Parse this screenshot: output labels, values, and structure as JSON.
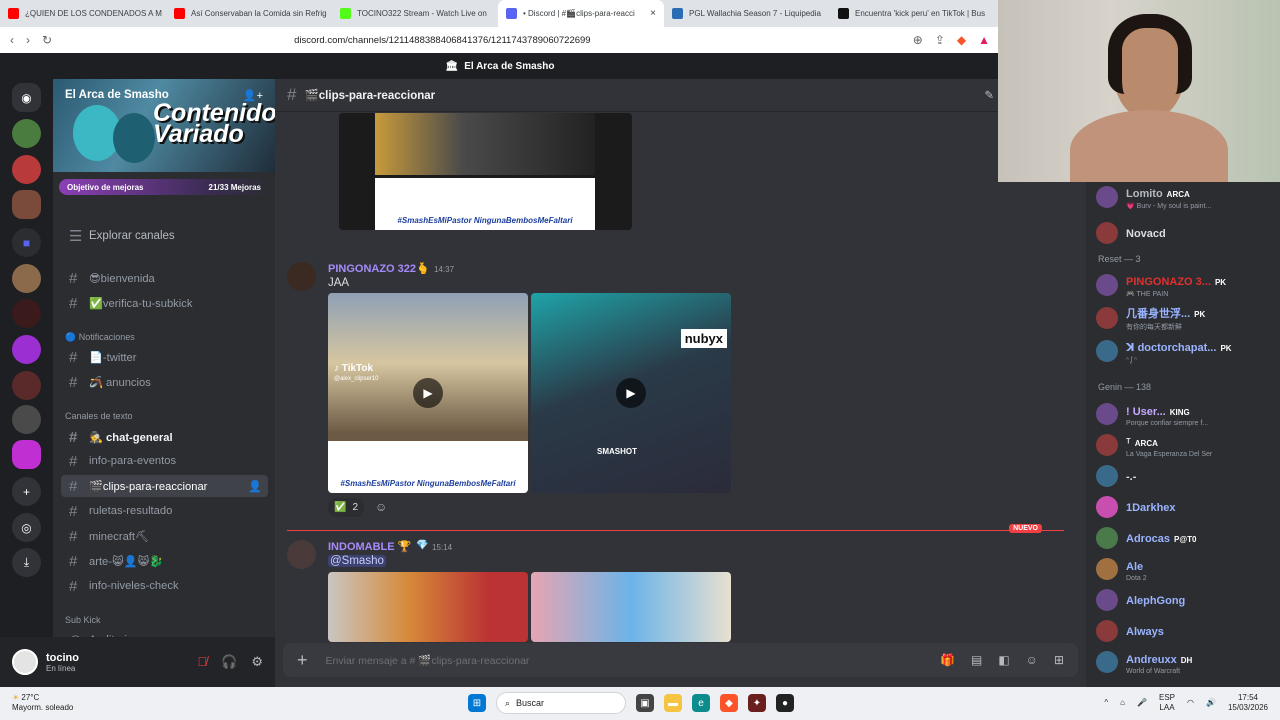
{
  "browser": {
    "tabs": [
      {
        "title": "¿QUIEN DE LOS CONDENADOS A M",
        "color": "#ff0000",
        "active": false
      },
      {
        "title": "Así Conservaban la Comida sin Refrig",
        "color": "#ff0000",
        "active": false
      },
      {
        "title": "TOCINO322 Stream - Watch Live on",
        "color": "#53fc18",
        "active": false
      },
      {
        "title": "• Discord | #🎬clips-para-reacci",
        "color": "#5865f2",
        "active": true
      },
      {
        "title": "PGL Wallachia Season 7 - Liquipedia",
        "color": "#2a6db5",
        "active": false
      },
      {
        "title": "Encuentra 'kick peru' en TikTok | Bus",
        "color": "#111111",
        "active": false
      }
    ],
    "url": "discord.com/channels/1211488388406841376/1211743789060722699"
  },
  "window_title": "El Arca de Smasho",
  "server": {
    "name": "El Arca de Smasho",
    "banner_text": "Contenido Variado",
    "boost_label": "Objetivo de mejoras",
    "boost_count": "21/33 Mejoras",
    "explore": "Explorar canales"
  },
  "channels": {
    "bienvenida": "😎bienvenida",
    "verifica": "✅verifica-tu-subkick",
    "cat_notif": "🔵 Notificaciones",
    "twitter": "📄-twitter",
    "anuncios": "🪃 anuncios",
    "cat_text": "Canales de texto",
    "chat_general": "🕵 chat-general",
    "info_eventos": "info-para-eventos",
    "clips": "🎬clips-para-reaccionar",
    "ruletas": "ruletas-resultado",
    "minecraft": "minecraft⛏",
    "arte": "arte-😸👤😸🐉",
    "niveles": "info-niveles-check",
    "cat_subkick": "Sub Kick",
    "auditoria": "Auditoria"
  },
  "user": {
    "name": "tocino",
    "status": "En línea"
  },
  "chat": {
    "channel_title": "🎬clips-para-reaccionar",
    "caption_text": "#SmashEsMiPastor NingunaBembosMeFaltari",
    "messages": [
      {
        "author": "PINGONAZO 322🫰",
        "time": "14:37",
        "text": "JAA",
        "color": "#a78bfa"
      },
      {
        "author": "INDOMABLE 🏆",
        "time": "15:14",
        "text": "@Smasho",
        "color": "#a78bfa"
      }
    ],
    "tiktok_label": "TikTok",
    "tiktok_handle": "@alex_clipser10",
    "nubyx": "nubyx",
    "smashot": "SMASHOT",
    "reaction": "✅",
    "reaction_count": "2",
    "new_badge": "NUEVO",
    "composer_placeholder": "Enviar mensaje a # 🎬clips-para-reaccionar"
  },
  "members": {
    "top": [
      {
        "name": "Lomito",
        "tag": "ARCA",
        "status": "💗 Burv - My soul is paint...",
        "color": "#b5bac1"
      },
      {
        "name": "Novacd",
        "tag": "",
        "status": "",
        "color": "#dbdee1"
      }
    ],
    "cat_reset": "Reset — 3",
    "reset": [
      {
        "name": "PINGONAZO 3...",
        "tag": "PK",
        "status": "🎮 THE PAIN",
        "color": "#e0312f"
      },
      {
        "name": "几番身世浮...",
        "tag": "PK",
        "status": "有你的每天都新鮮",
        "color": "#9ab4ff"
      },
      {
        "name": "ꓘ doctorchapat...",
        "tag": "PK",
        "status": "ᐢ ᶘ ᐢ",
        "color": "#9ab4ff"
      }
    ],
    "cat_genin": "Genin — 138",
    "genin": [
      {
        "name": "! User...",
        "tag": "KING",
        "status": "Porque confiar siempre f...",
        "color": "#c9a8ff"
      },
      {
        "name": "ᵀ",
        "tag": "ARCA",
        "status": "La Vaga Esperanza Del Ser",
        "color": "#dbdee1"
      },
      {
        "name": "-.-",
        "tag": "",
        "status": "",
        "color": "#dbdee1"
      },
      {
        "name": "1Darkhex",
        "tag": "",
        "status": "",
        "color": "#9ab4ff"
      },
      {
        "name": "Adrocas",
        "tag": "P@T0",
        "status": "",
        "color": "#9ab4ff"
      },
      {
        "name": "Ale",
        "tag": "",
        "status": "Dota 2",
        "color": "#9ab4ff"
      },
      {
        "name": "AlephGong",
        "tag": "",
        "status": "",
        "color": "#9ab4ff"
      },
      {
        "name": "Always",
        "tag": "",
        "status": "",
        "color": "#9ab4ff"
      },
      {
        "name": "Andreuxx",
        "tag": "DH",
        "status": "World of Warcraft",
        "color": "#9ab4ff"
      }
    ]
  },
  "taskbar": {
    "temp": "27°C",
    "weather": "Mayorm. soleado",
    "search": "Buscar",
    "lang": "ESP",
    "lang2": "LAA",
    "time": "17:54",
    "date": "15/03/2026"
  }
}
